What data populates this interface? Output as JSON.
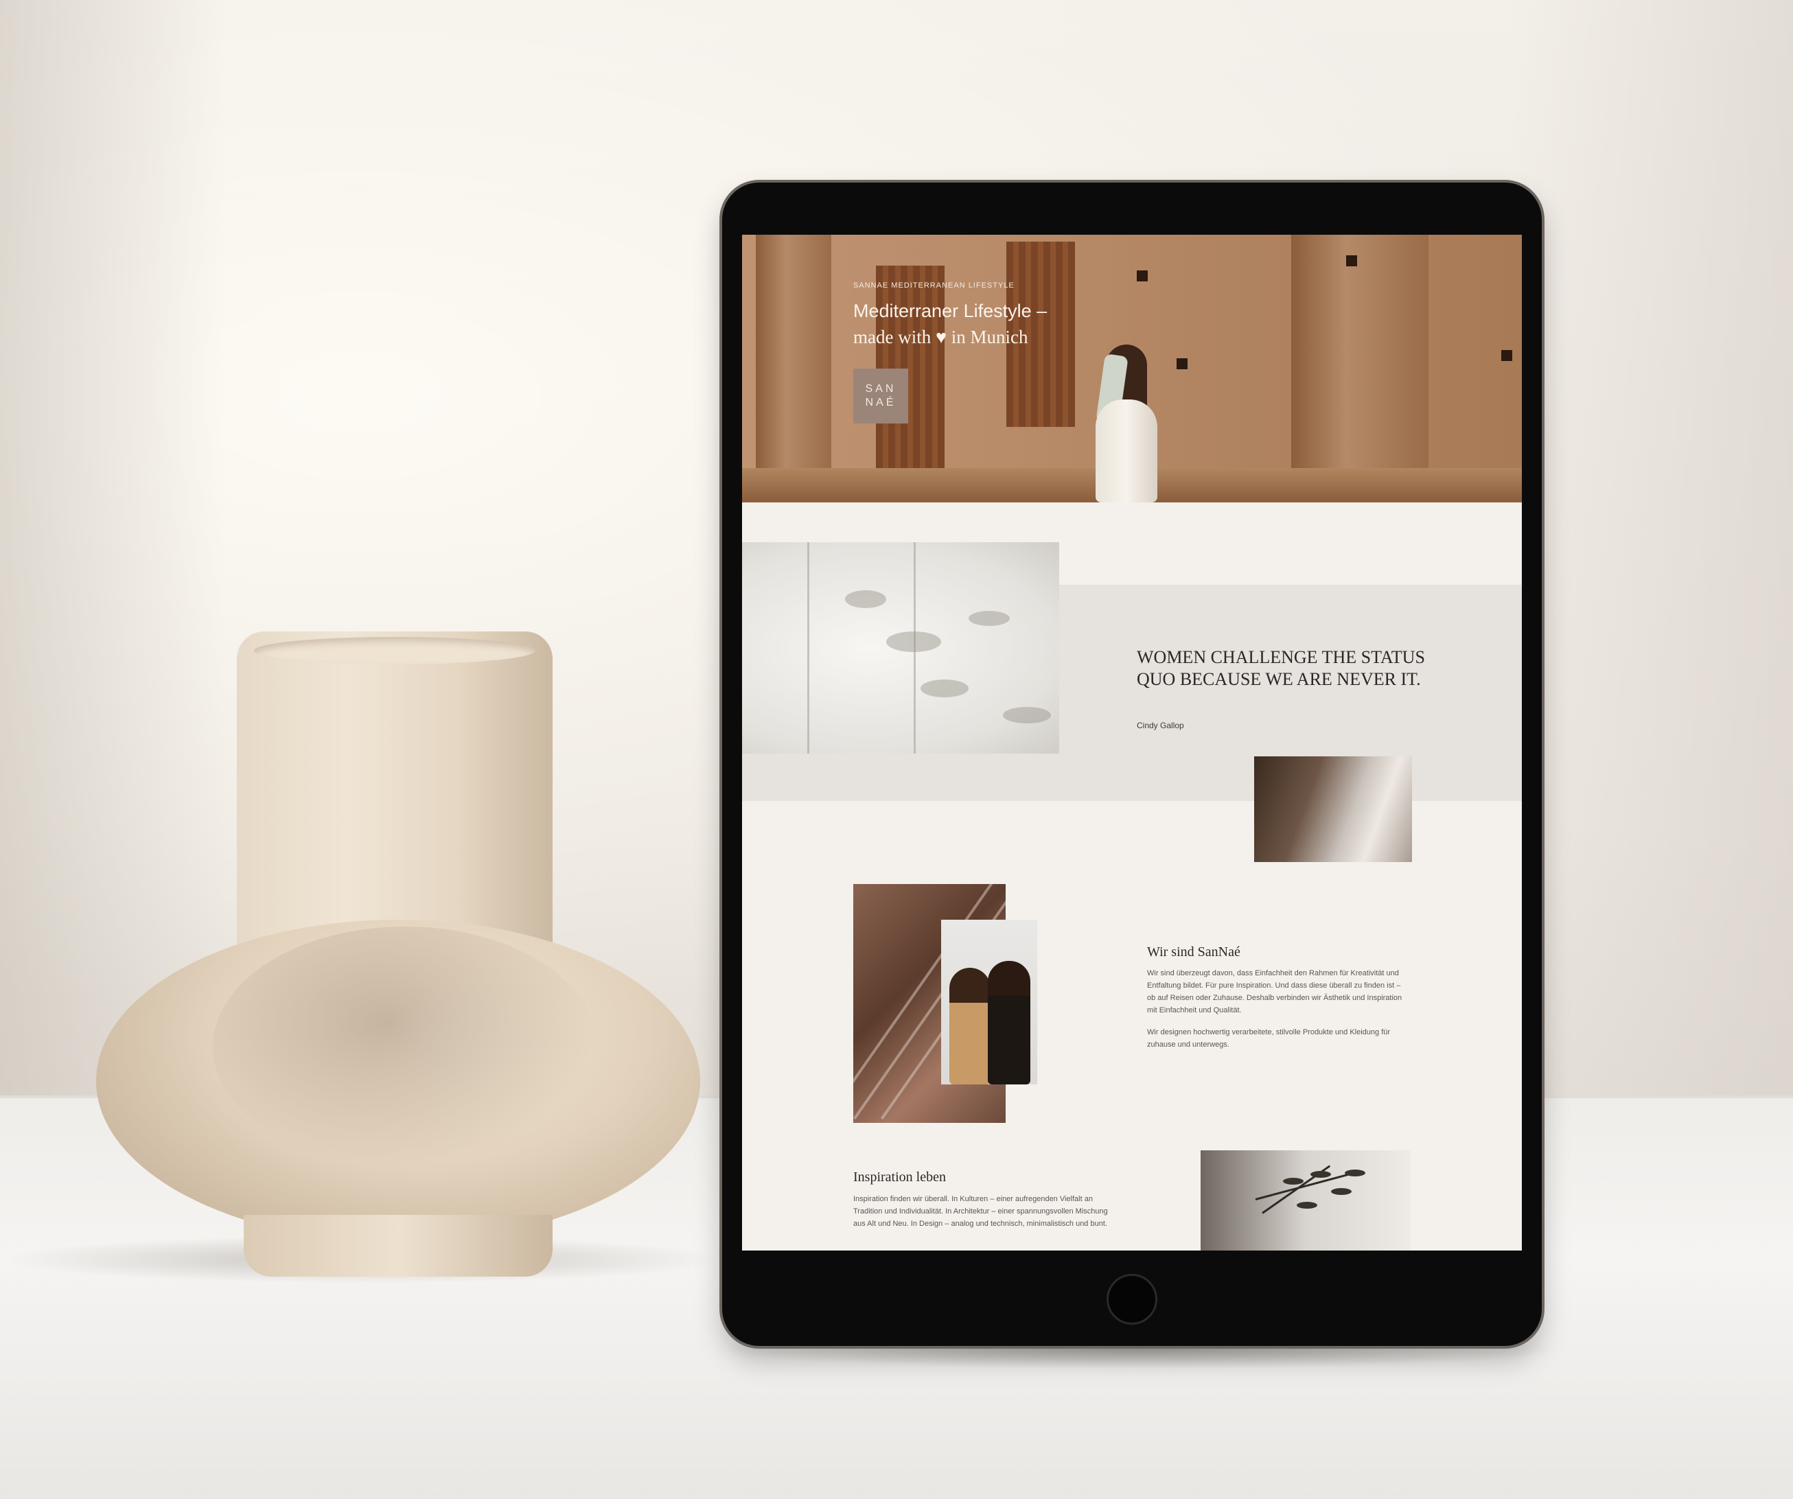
{
  "hero": {
    "kicker": "SANNAE MEDITERRANEAN LIFESTYLE",
    "title_line1": "Mediterraner Lifestyle –",
    "title_line2": "made with ♥ in Munich",
    "logo_line1": "SAN",
    "logo_line2": "NAÉ"
  },
  "quote": {
    "text": "WOMEN CHALLENGE THE STATUS QUO BECAUSE WE ARE NEVER IT.",
    "author": "Cindy Gallop"
  },
  "about": {
    "title": "Wir sind SanNaé",
    "paragraph1": "Wir sind überzeugt davon, dass Einfachheit den Rahmen für Kreativität und Entfaltung bildet. Für pure Inspiration. Und dass diese überall zu finden ist – ob auf Reisen oder Zuhause. Deshalb verbinden wir Ästhetik und Inspiration mit Einfachheit und Qualität.",
    "paragraph2": "Wir designen hochwertig verarbeitete, stilvolle Produkte und Kleidung für zuhause und unterwegs."
  },
  "inspiration": {
    "title": "Inspiration leben",
    "paragraph": "Inspiration finden wir überall. In Kulturen – einer aufregenden Vielfalt an Tradition und Individualität. In Architektur – einer spannungsvollen Mischung aus Alt und Neu. In Design – analog und technisch, minimalistisch und bunt."
  },
  "colors": {
    "page_background": "#f4f1ed",
    "quote_band": "#e6e2de",
    "logo_box": "#9b8578",
    "text_dark": "#2b2724"
  }
}
